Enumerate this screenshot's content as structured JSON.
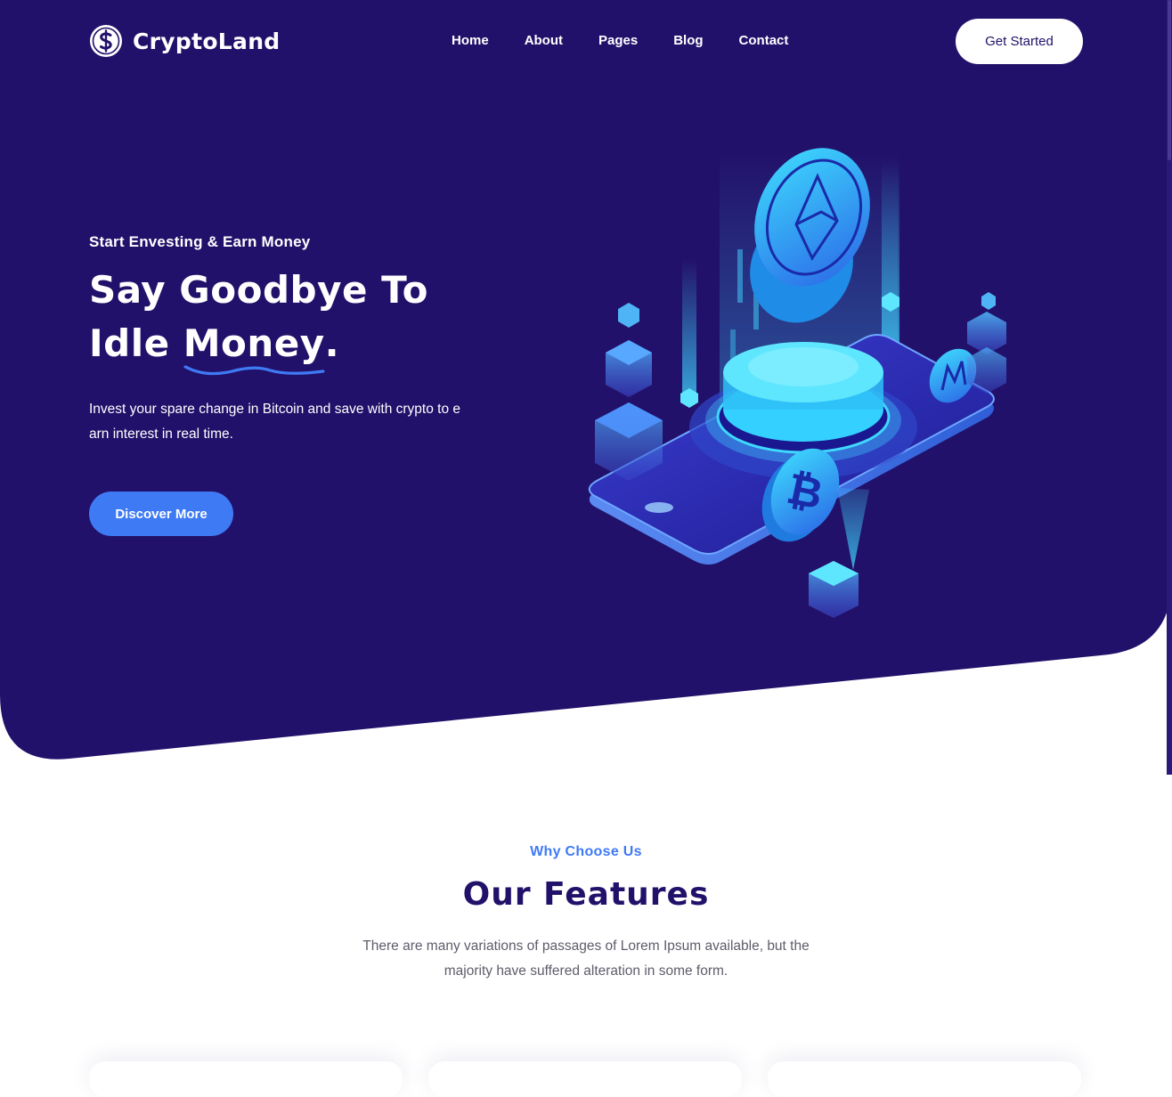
{
  "colors": {
    "hero_bg": "#22116a",
    "accent_blue": "#3f7af5",
    "title_navy": "#22116a",
    "text_gray": "#5d5d6b",
    "white": "#ffffff"
  },
  "header": {
    "brand": "CryptoLand",
    "logo_icon": "dollar-coin-icon",
    "nav": [
      "Home",
      "About",
      "Pages",
      "Blog",
      "Contact"
    ],
    "cta": "Get Started"
  },
  "hero": {
    "eyebrow": "Start Envesting & Earn Money",
    "headline_line1": "Say Goodbye To",
    "headline_line2_a": "Idle ",
    "headline_highlight": "Money",
    "headline_end": ".",
    "description": "Invest your spare change in Bitcoin and save with crypto to e arn interest in real time.",
    "button": "Discover More",
    "illustration": "crypto-phone-isometric-illustration"
  },
  "features": {
    "eyebrow": "Why Choose Us",
    "title": "Our Features",
    "description": "There are many variations of passages of Lorem Ipsum available, but the majority have suffered alteration in some form."
  }
}
